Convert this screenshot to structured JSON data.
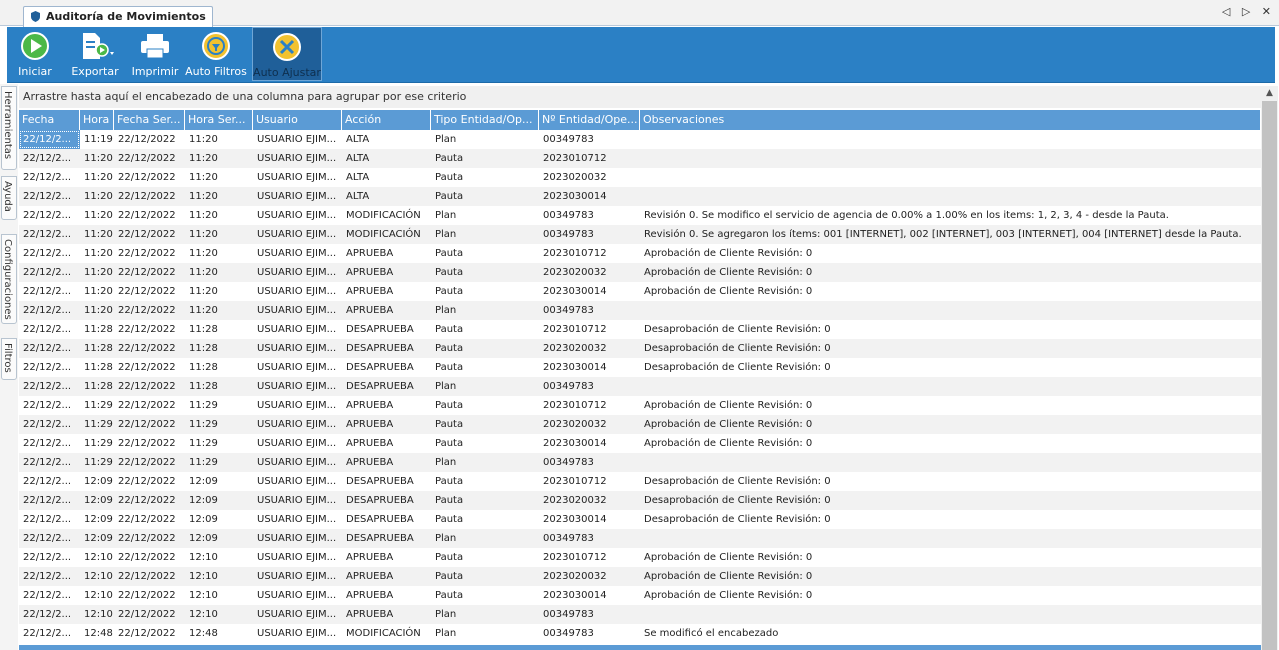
{
  "tab": {
    "title": "Auditoría de Movimientos",
    "controls": "◁ ▷ ✕"
  },
  "toolbar": {
    "buttons": [
      {
        "label": "Iniciar",
        "icon": "play-icon"
      },
      {
        "label": "Exportar",
        "icon": "export-icon"
      },
      {
        "label": "Imprimir",
        "icon": "printer-icon"
      },
      {
        "label": "Auto Filtros",
        "icon": "auto-filter-icon"
      },
      {
        "label": "Auto Ajustar",
        "icon": "auto-fit-icon",
        "active": true
      }
    ]
  },
  "side_tabs": [
    "Herramientas",
    "Ayuda",
    "Configuraciones",
    "Filtros"
  ],
  "grid": {
    "group_hint": "Arrastre hasta aquí el encabezado de una columna para agrupar por ese criterio",
    "columns": [
      "Fecha",
      "Hora",
      "Fecha Ser...",
      "Hora Ser...",
      "Usuario",
      "Acción",
      "Tipo Entidad/Op...",
      "Nº Entidad/Ope...",
      "Observaciones"
    ],
    "rows": [
      [
        "22/12/2...",
        "11:19",
        "22/12/2022",
        "11:20",
        "USUARIO EJIM...",
        "ALTA",
        "Plan",
        "00349783",
        ""
      ],
      [
        "22/12/2...",
        "11:20",
        "22/12/2022",
        "11:20",
        "USUARIO EJIM...",
        "ALTA",
        "Pauta",
        "2023010712",
        ""
      ],
      [
        "22/12/2...",
        "11:20",
        "22/12/2022",
        "11:20",
        "USUARIO EJIM...",
        "ALTA",
        "Pauta",
        "2023020032",
        ""
      ],
      [
        "22/12/2...",
        "11:20",
        "22/12/2022",
        "11:20",
        "USUARIO EJIM...",
        "ALTA",
        "Pauta",
        "2023030014",
        ""
      ],
      [
        "22/12/2...",
        "11:20",
        "22/12/2022",
        "11:20",
        "USUARIO EJIM...",
        "MODIFICACIÓN",
        "Plan",
        "00349783",
        "Revisión 0. Se modifico el servicio de agencia de  0.00% a 1.00% en los items: 1, 2, 3, 4 -  desde la Pauta."
      ],
      [
        "22/12/2...",
        "11:20",
        "22/12/2022",
        "11:20",
        "USUARIO EJIM...",
        "MODIFICACIÓN",
        "Plan",
        "00349783",
        "Revisión 0. Se agregaron los ítems: 001 [INTERNET], 002 [INTERNET], 003 [INTERNET], 004 [INTERNET] desde la Pauta."
      ],
      [
        "22/12/2...",
        "11:20",
        "22/12/2022",
        "11:20",
        "USUARIO EJIM...",
        "APRUEBA",
        "Pauta",
        "2023010712",
        "Aprobación de Cliente Revisión: 0"
      ],
      [
        "22/12/2...",
        "11:20",
        "22/12/2022",
        "11:20",
        "USUARIO EJIM...",
        "APRUEBA",
        "Pauta",
        "2023020032",
        "Aprobación de Cliente Revisión: 0"
      ],
      [
        "22/12/2...",
        "11:20",
        "22/12/2022",
        "11:20",
        "USUARIO EJIM...",
        "APRUEBA",
        "Pauta",
        "2023030014",
        "Aprobación de Cliente Revisión: 0"
      ],
      [
        "22/12/2...",
        "11:20",
        "22/12/2022",
        "11:20",
        "USUARIO EJIM...",
        "APRUEBA",
        "Plan",
        "00349783",
        ""
      ],
      [
        "22/12/2...",
        "11:28",
        "22/12/2022",
        "11:28",
        "USUARIO EJIM...",
        "DESAPRUEBA",
        "Pauta",
        "2023010712",
        "Desaprobación de Cliente Revisión: 0"
      ],
      [
        "22/12/2...",
        "11:28",
        "22/12/2022",
        "11:28",
        "USUARIO EJIM...",
        "DESAPRUEBA",
        "Pauta",
        "2023020032",
        "Desaprobación de Cliente Revisión: 0"
      ],
      [
        "22/12/2...",
        "11:28",
        "22/12/2022",
        "11:28",
        "USUARIO EJIM...",
        "DESAPRUEBA",
        "Pauta",
        "2023030014",
        "Desaprobación de Cliente Revisión: 0"
      ],
      [
        "22/12/2...",
        "11:28",
        "22/12/2022",
        "11:28",
        "USUARIO EJIM...",
        "DESAPRUEBA",
        "Plan",
        "00349783",
        ""
      ],
      [
        "22/12/2...",
        "11:29",
        "22/12/2022",
        "11:29",
        "USUARIO EJIM...",
        "APRUEBA",
        "Pauta",
        "2023010712",
        "Aprobación de Cliente Revisión: 0"
      ],
      [
        "22/12/2...",
        "11:29",
        "22/12/2022",
        "11:29",
        "USUARIO EJIM...",
        "APRUEBA",
        "Pauta",
        "2023020032",
        "Aprobación de Cliente Revisión: 0"
      ],
      [
        "22/12/2...",
        "11:29",
        "22/12/2022",
        "11:29",
        "USUARIO EJIM...",
        "APRUEBA",
        "Pauta",
        "2023030014",
        "Aprobación de Cliente Revisión: 0"
      ],
      [
        "22/12/2...",
        "11:29",
        "22/12/2022",
        "11:29",
        "USUARIO EJIM...",
        "APRUEBA",
        "Plan",
        "00349783",
        ""
      ],
      [
        "22/12/2...",
        "12:09",
        "22/12/2022",
        "12:09",
        "USUARIO EJIM...",
        "DESAPRUEBA",
        "Pauta",
        "2023010712",
        "Desaprobación de Cliente Revisión: 0"
      ],
      [
        "22/12/2...",
        "12:09",
        "22/12/2022",
        "12:09",
        "USUARIO EJIM...",
        "DESAPRUEBA",
        "Pauta",
        "2023020032",
        "Desaprobación de Cliente Revisión: 0"
      ],
      [
        "22/12/2...",
        "12:09",
        "22/12/2022",
        "12:09",
        "USUARIO EJIM...",
        "DESAPRUEBA",
        "Pauta",
        "2023030014",
        "Desaprobación de Cliente Revisión: 0"
      ],
      [
        "22/12/2...",
        "12:09",
        "22/12/2022",
        "12:09",
        "USUARIO EJIM...",
        "DESAPRUEBA",
        "Plan",
        "00349783",
        ""
      ],
      [
        "22/12/2...",
        "12:10",
        "22/12/2022",
        "12:10",
        "USUARIO EJIM...",
        "APRUEBA",
        "Pauta",
        "2023010712",
        "Aprobación de Cliente Revisión: 0"
      ],
      [
        "22/12/2...",
        "12:10",
        "22/12/2022",
        "12:10",
        "USUARIO EJIM...",
        "APRUEBA",
        "Pauta",
        "2023020032",
        "Aprobación de Cliente Revisión: 0"
      ],
      [
        "22/12/2...",
        "12:10",
        "22/12/2022",
        "12:10",
        "USUARIO EJIM...",
        "APRUEBA",
        "Pauta",
        "2023030014",
        "Aprobación de Cliente Revisión: 0"
      ],
      [
        "22/12/2...",
        "12:10",
        "22/12/2022",
        "12:10",
        "USUARIO EJIM...",
        "APRUEBA",
        "Plan",
        "00349783",
        ""
      ],
      [
        "22/12/2...",
        "12:48",
        "22/12/2022",
        "12:48",
        "USUARIO EJIM...",
        "MODIFICACIÓN",
        "Plan",
        "00349783",
        "Se modificó el encabezado"
      ]
    ]
  },
  "colors": {
    "toolbar": "#2b80c5",
    "header": "#5b9bd5",
    "selection": "#5b9bd5"
  }
}
